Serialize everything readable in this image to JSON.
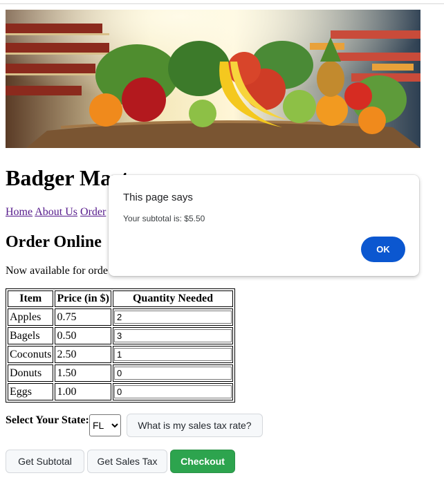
{
  "header": {
    "title": "Badger Mart",
    "banner_alt": "Basket of fresh fruits and vegetables in a grocery store aisle"
  },
  "nav": {
    "items": [
      {
        "label": "Home"
      },
      {
        "label": "About Us"
      },
      {
        "label": "Order"
      }
    ]
  },
  "main": {
    "section_title": "Order Online",
    "intro_text": "Now available for orde"
  },
  "order_table": {
    "columns": [
      "Item",
      "Price (in $)",
      "Quantity Needed"
    ],
    "rows": [
      {
        "item": "Apples",
        "price": "0.75",
        "quantity": "2"
      },
      {
        "item": "Bagels",
        "price": "0.50",
        "quantity": "3"
      },
      {
        "item": "Coconuts",
        "price": "2.50",
        "quantity": "1"
      },
      {
        "item": "Donuts",
        "price": "1.50",
        "quantity": "0"
      },
      {
        "item": "Eggs",
        "price": "1.00",
        "quantity": "0"
      }
    ]
  },
  "state": {
    "label": "Select Your State:",
    "selected": "FL",
    "tax_button_label": "What is my sales tax rate?"
  },
  "actions": {
    "subtotal_label": "Get Subtotal",
    "sales_tax_label": "Get Sales Tax",
    "checkout_label": "Checkout"
  },
  "dialog": {
    "title": "This page says",
    "message": "Your subtotal is: $5.50",
    "ok_label": "OK"
  },
  "colors": {
    "link": "#551a8b",
    "checkout": "#2da44e",
    "dialog_ok": "#0b57d0"
  }
}
